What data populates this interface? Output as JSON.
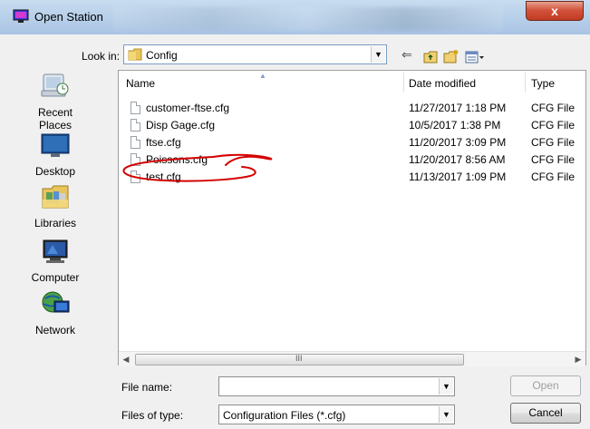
{
  "window": {
    "title": "Open Station",
    "close_glyph": "x"
  },
  "look_in": {
    "label": "Look in:",
    "value": "Config"
  },
  "toolbar": {
    "icons": [
      "back-icon",
      "up-folder-icon",
      "new-folder-icon",
      "view-menu-icon"
    ]
  },
  "places": [
    {
      "label": "Recent Places",
      "icon": "recent-places-icon"
    },
    {
      "label": "Desktop",
      "icon": "desktop-icon"
    },
    {
      "label": "Libraries",
      "icon": "libraries-icon"
    },
    {
      "label": "Computer",
      "icon": "computer-icon"
    },
    {
      "label": "Network",
      "icon": "network-icon"
    }
  ],
  "columns": {
    "name": "Name",
    "date": "Date modified",
    "type": "Type"
  },
  "files": [
    {
      "name": "customer-ftse.cfg",
      "date": "11/27/2017 1:18 PM",
      "type": "CFG File"
    },
    {
      "name": "Disp Gage.cfg",
      "date": "10/5/2017 1:38 PM",
      "type": "CFG File"
    },
    {
      "name": "ftse.cfg",
      "date": "11/20/2017 3:09 PM",
      "type": "CFG File"
    },
    {
      "name": "Poissons.cfg",
      "date": "11/20/2017 8:56 AM",
      "type": "CFG File"
    },
    {
      "name": "test.cfg",
      "date": "11/13/2017 1:09 PM",
      "type": "CFG File"
    }
  ],
  "scrollbar": {
    "grip": "III"
  },
  "file_name": {
    "label": "File name:",
    "value": ""
  },
  "file_type": {
    "label": "Files of type:",
    "value": "Configuration Files (*.cfg)"
  },
  "buttons": {
    "open": "Open",
    "cancel": "Cancel"
  },
  "colors": {
    "annotation": "#d40000",
    "title_gradient": "#b9d1ea",
    "close": "#c23a22"
  }
}
